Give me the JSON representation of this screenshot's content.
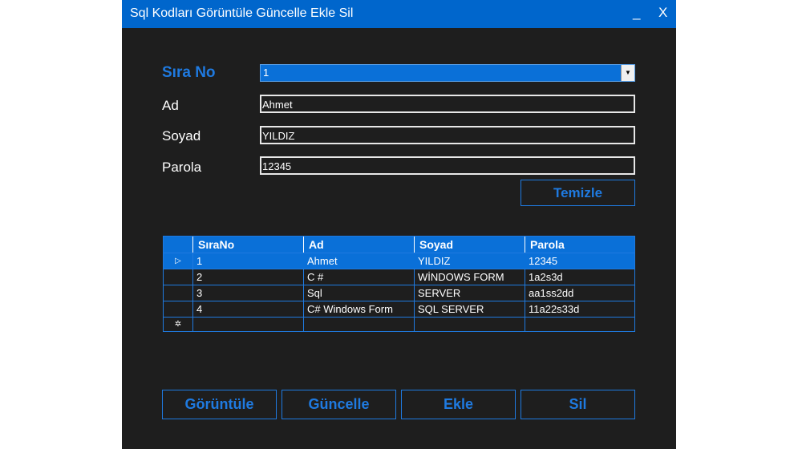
{
  "window": {
    "title": "Sql Kodları Görüntüle Güncelle Ekle Sil",
    "minimize_label": "_",
    "close_label": "X"
  },
  "form": {
    "sirano_label": "Sıra No",
    "sirano_value": "1",
    "ad_label": "Ad",
    "ad_value": "Ahmet",
    "soyad_label": "Soyad",
    "soyad_value": "YILDIZ",
    "parola_label": "Parola",
    "parola_value": "12345",
    "temizle_label": "Temizle"
  },
  "grid": {
    "columns": [
      "SıraNo",
      "Ad",
      "Soyad",
      "Parola"
    ],
    "rows": [
      [
        "1",
        "Ahmet",
        "YILDIZ",
        "12345"
      ],
      [
        "2",
        "C #",
        "WİNDOWS FORM",
        "1a2s3d"
      ],
      [
        "3",
        "Sql",
        "SERVER",
        "aa1ss2dd"
      ],
      [
        "4",
        "C# Windows Form",
        "SQL SERVER",
        "11a22s33d"
      ]
    ]
  },
  "actions": {
    "goruntule_label": "Görüntüle",
    "guncelle_label": "Güncelle",
    "ekle_label": "Ekle",
    "sil_label": "Sil"
  },
  "colors": {
    "accent": "#1f7ae0",
    "titlebar": "#0066cc",
    "background": "#1e1e1e"
  }
}
